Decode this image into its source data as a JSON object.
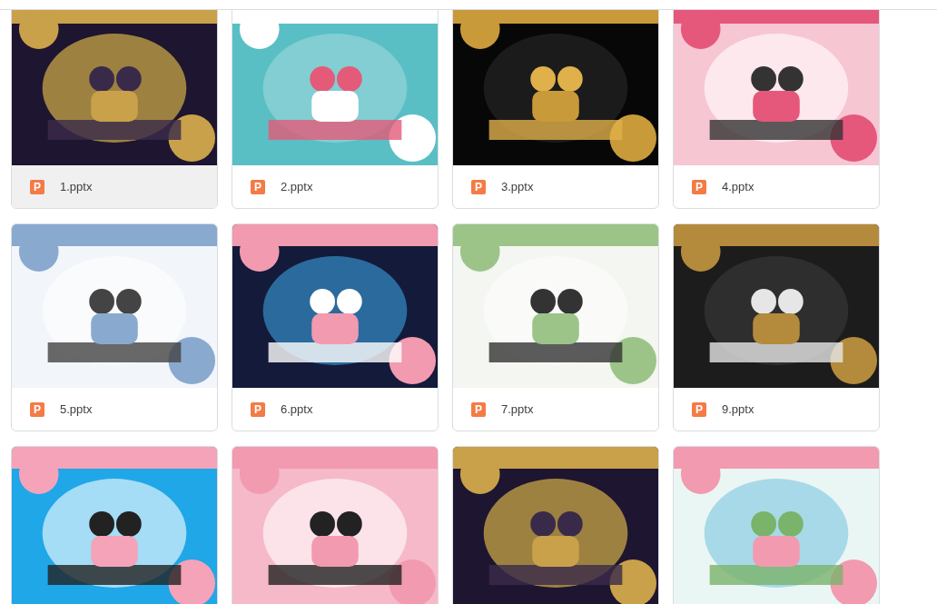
{
  "files": [
    {
      "name": "1.pptx",
      "type_icon": "P",
      "selected": true,
      "thumbnail": {
        "kind": "picture"
      }
    },
    {
      "name": "2.pptx",
      "type_icon": "P",
      "selected": false,
      "thumbnail": {
        "kind": "picture"
      }
    },
    {
      "name": "3.pptx",
      "type_icon": "P",
      "selected": false,
      "thumbnail": {
        "kind": "picture"
      }
    },
    {
      "name": "4.pptx",
      "type_icon": "P",
      "selected": false,
      "thumbnail": {
        "kind": "picture"
      }
    },
    {
      "name": "5.pptx",
      "type_icon": "P",
      "selected": false,
      "thumbnail": {
        "kind": "picture"
      }
    },
    {
      "name": "6.pptx",
      "type_icon": "P",
      "selected": false,
      "thumbnail": {
        "kind": "picture"
      }
    },
    {
      "name": "7.pptx",
      "type_icon": "P",
      "selected": false,
      "thumbnail": {
        "kind": "picture"
      }
    },
    {
      "name": "9.pptx",
      "type_icon": "P",
      "selected": false,
      "thumbnail": {
        "kind": "picture"
      }
    },
    {
      "thumbnail": {
        "kind": "picture"
      }
    },
    {
      "thumbnail": {
        "kind": "picture"
      }
    },
    {
      "thumbnail": {
        "kind": "picture"
      }
    },
    {
      "thumbnail": {
        "kind": "picture"
      }
    }
  ]
}
